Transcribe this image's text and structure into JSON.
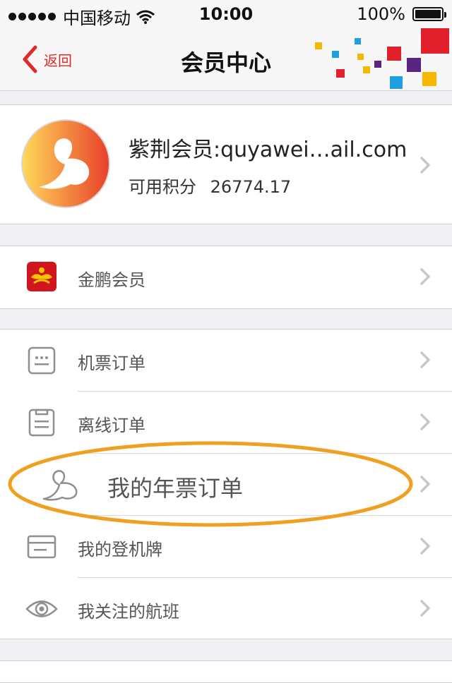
{
  "status_bar": {
    "carrier": "中国移动",
    "time": "10:00",
    "battery": "100%"
  },
  "nav": {
    "back_label": "返回",
    "title": "会员中心"
  },
  "profile": {
    "member_name": "紫荆会员:quyawei…ail.com",
    "points_label": "可用积分",
    "points_value": "26774.17"
  },
  "groups": {
    "loyalty": [
      {
        "label": "金鹏会员",
        "icon": "golden-roc-logo-icon"
      }
    ],
    "orders": [
      {
        "label": "机票订单",
        "icon": "ticket-order-icon"
      },
      {
        "label": "离线订单",
        "icon": "offline-order-icon"
      },
      {
        "label": "我的年票订单",
        "icon": "annual-ticket-icon"
      },
      {
        "label": "我的登机牌",
        "icon": "boarding-pass-icon"
      },
      {
        "label": "我关注的航班",
        "icon": "eye-icon"
      }
    ]
  },
  "colors": {
    "accent": "#e02a2a",
    "highlight": "#f0a020",
    "background": "#efeff4"
  }
}
